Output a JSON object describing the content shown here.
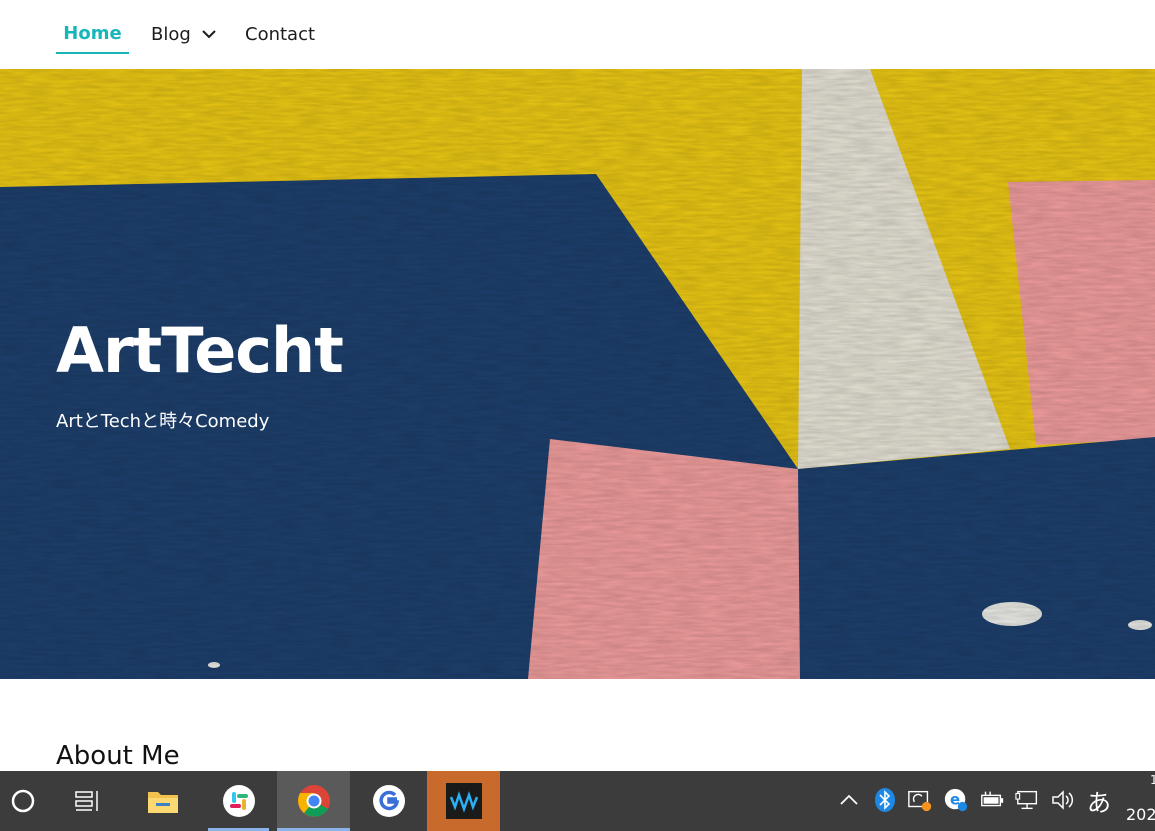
{
  "nav": {
    "items": [
      {
        "label": "Home",
        "active": true
      },
      {
        "label": "Blog",
        "has_dropdown": true
      },
      {
        "label": "Contact"
      }
    ],
    "accent_color": "#18b6b8"
  },
  "hero": {
    "title": "ArtTecht",
    "subtitle": "ArtとTechと時々Comedy",
    "colors": {
      "yellow": "#e9c614",
      "blue": "#1d3f6c",
      "pink": "#ef9c9c",
      "cream": "#e4e0d4"
    }
  },
  "content": {
    "section_heading": "About Me"
  },
  "taskbar": {
    "apps": [
      {
        "name": "cortana-circle-icon"
      },
      {
        "name": "task-view-icon"
      },
      {
        "name": "file-explorer-icon"
      },
      {
        "name": "slack-icon",
        "running": true
      },
      {
        "name": "chrome-icon",
        "running": true,
        "active": true
      },
      {
        "name": "g-app-icon"
      },
      {
        "name": "waves-app-icon",
        "highlighted": true
      }
    ],
    "tray": [
      "chevron-up-icon",
      "bluetooth-icon",
      "sync-icon",
      "e-app-icon",
      "battery-icon",
      "network-icon",
      "volume-icon"
    ],
    "ime_label": "あ",
    "clock_year": "202",
    "clock_time": "1"
  }
}
